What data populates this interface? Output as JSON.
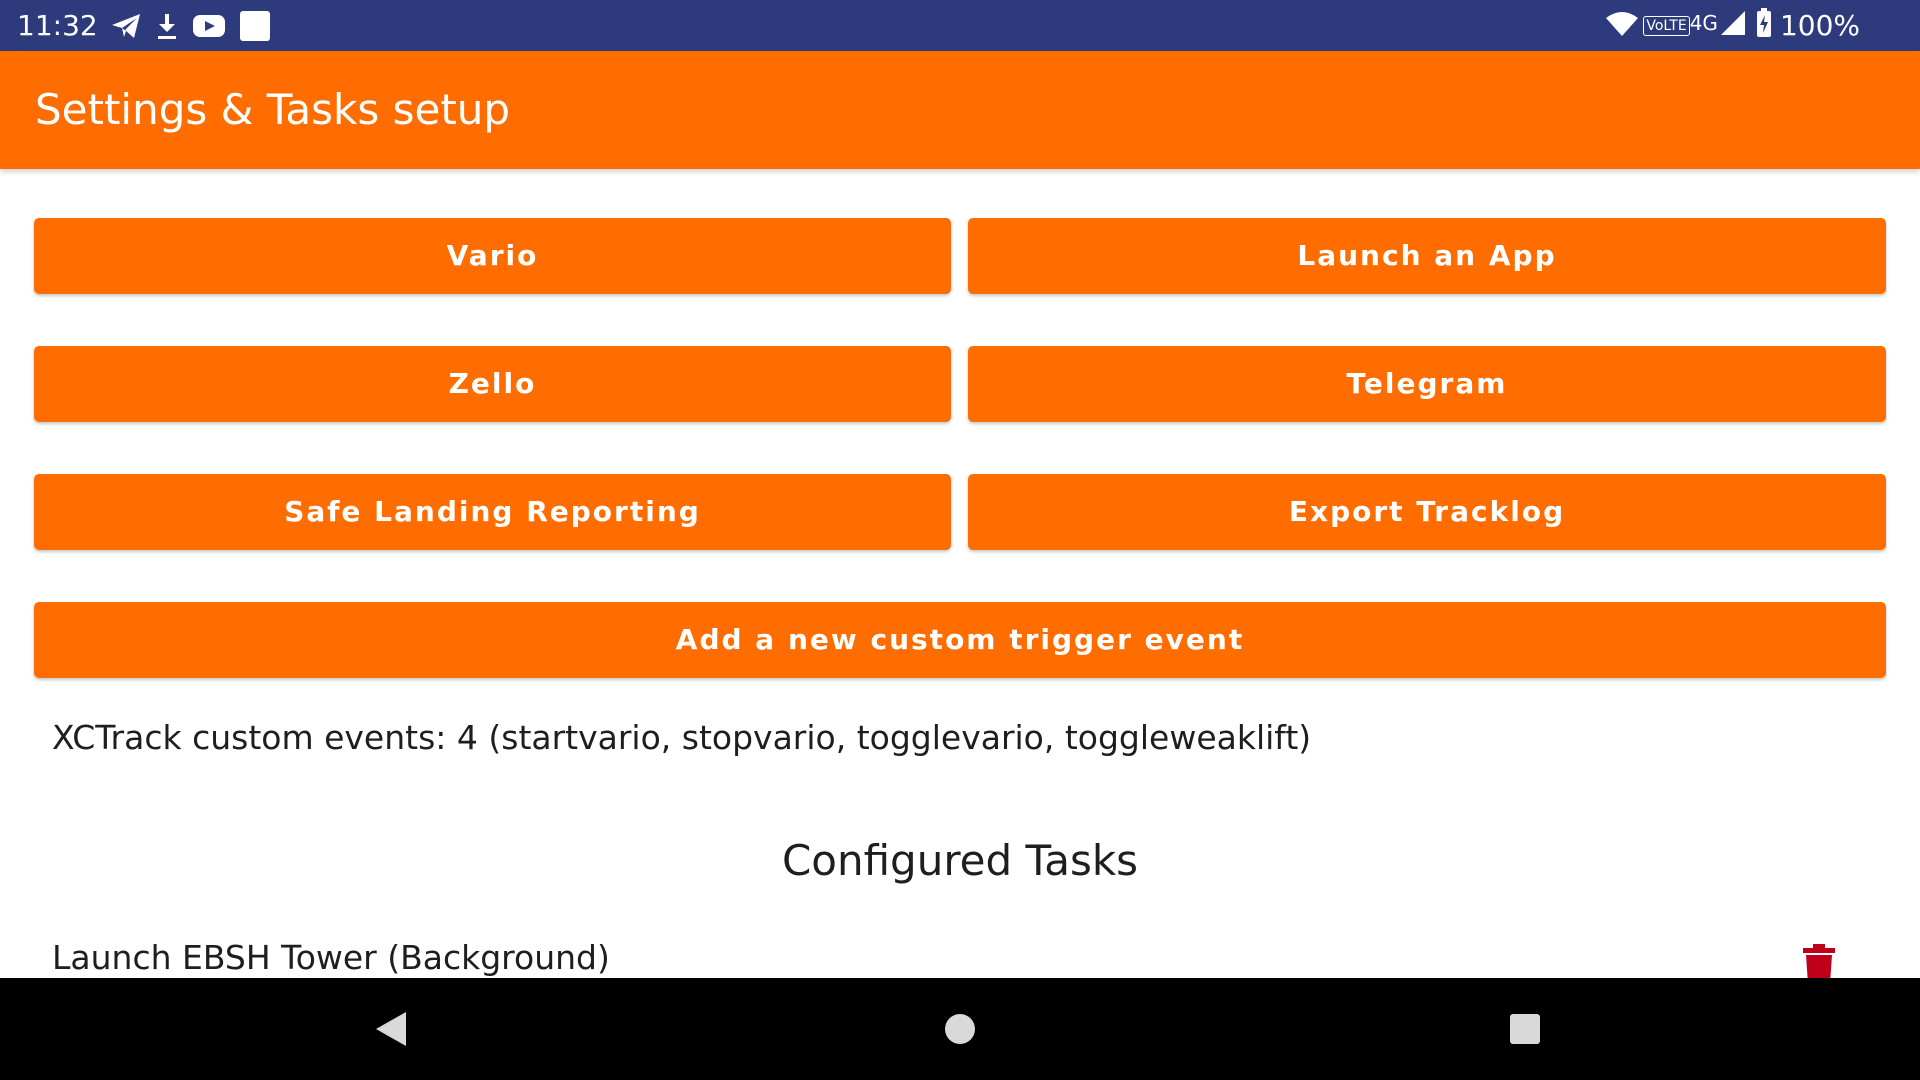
{
  "status_bar": {
    "time": "11:32",
    "left_icons": [
      "telegram-icon",
      "download-icon",
      "youtube-icon",
      "notification-square-icon"
    ],
    "volte": "VoLTE",
    "network_type": "4G",
    "battery_percent": "100%"
  },
  "app_bar": {
    "title": "Settings & Tasks setup",
    "color": "#ff6d00"
  },
  "buttons": {
    "vario": "Vario",
    "launch_app": "Launch an App",
    "zello": "Zello",
    "telegram": "Telegram",
    "safe_landing": "Safe Landing Reporting",
    "export_tracklog": "Export Tracklog",
    "add_custom_trigger": "Add a new custom trigger event"
  },
  "xctrack_info": "XCTrack custom events: 4 (startvario, stopvario, togglevario, toggleweaklift)",
  "configured_tasks": {
    "title": "Configured Tasks",
    "items": [
      {
        "label": "Launch EBSH Tower (Background)",
        "action_icon": "trash-icon",
        "action_color": "#c0001a"
      }
    ]
  },
  "nav_bar": {
    "buttons": [
      "back-icon",
      "home-icon",
      "recents-icon"
    ]
  }
}
